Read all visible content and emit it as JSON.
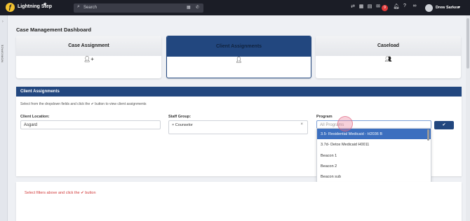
{
  "app": {
    "name": "Lightning Step"
  },
  "search": {
    "placeholder": "Search"
  },
  "topbar": {
    "notif_count": "9",
    "user": "Drew Sarkes"
  },
  "leftrail": {
    "label": "WORKSPACE"
  },
  "page": {
    "title": "Case Management Dashboard"
  },
  "cards": [
    {
      "label": "Case Assignment",
      "icon": "user-plus-icon"
    },
    {
      "label": "Client Assignments",
      "icon": "user-icon"
    },
    {
      "label": "Caseload",
      "icon": "users-icon"
    }
  ],
  "panel": {
    "title": "Client Assignments",
    "instructions": "Select from the dropdown fields and click the ✔ button to view client assignments",
    "client_location": {
      "label": "Client Location:",
      "value": "Asgard"
    },
    "staff_group": {
      "label": "Staff Group:",
      "chip": "× Counselor"
    },
    "program": {
      "label": "Program",
      "placeholder": "All Programs"
    }
  },
  "dropdown": {
    "options": [
      "3.5- Residential Medicaid - H2036 B",
      "3.7d- Detox Medicaid H0011",
      "Beacon 1",
      "Beacon 2",
      "Beacon sub"
    ],
    "selected_index": 0
  },
  "message": {
    "text": "Select filters above and click the ✔ button"
  },
  "colors": {
    "primary": "#22477f",
    "highlight": "#3c6fbf",
    "alert": "#d13a3a",
    "topbar": "#1b1d26"
  }
}
